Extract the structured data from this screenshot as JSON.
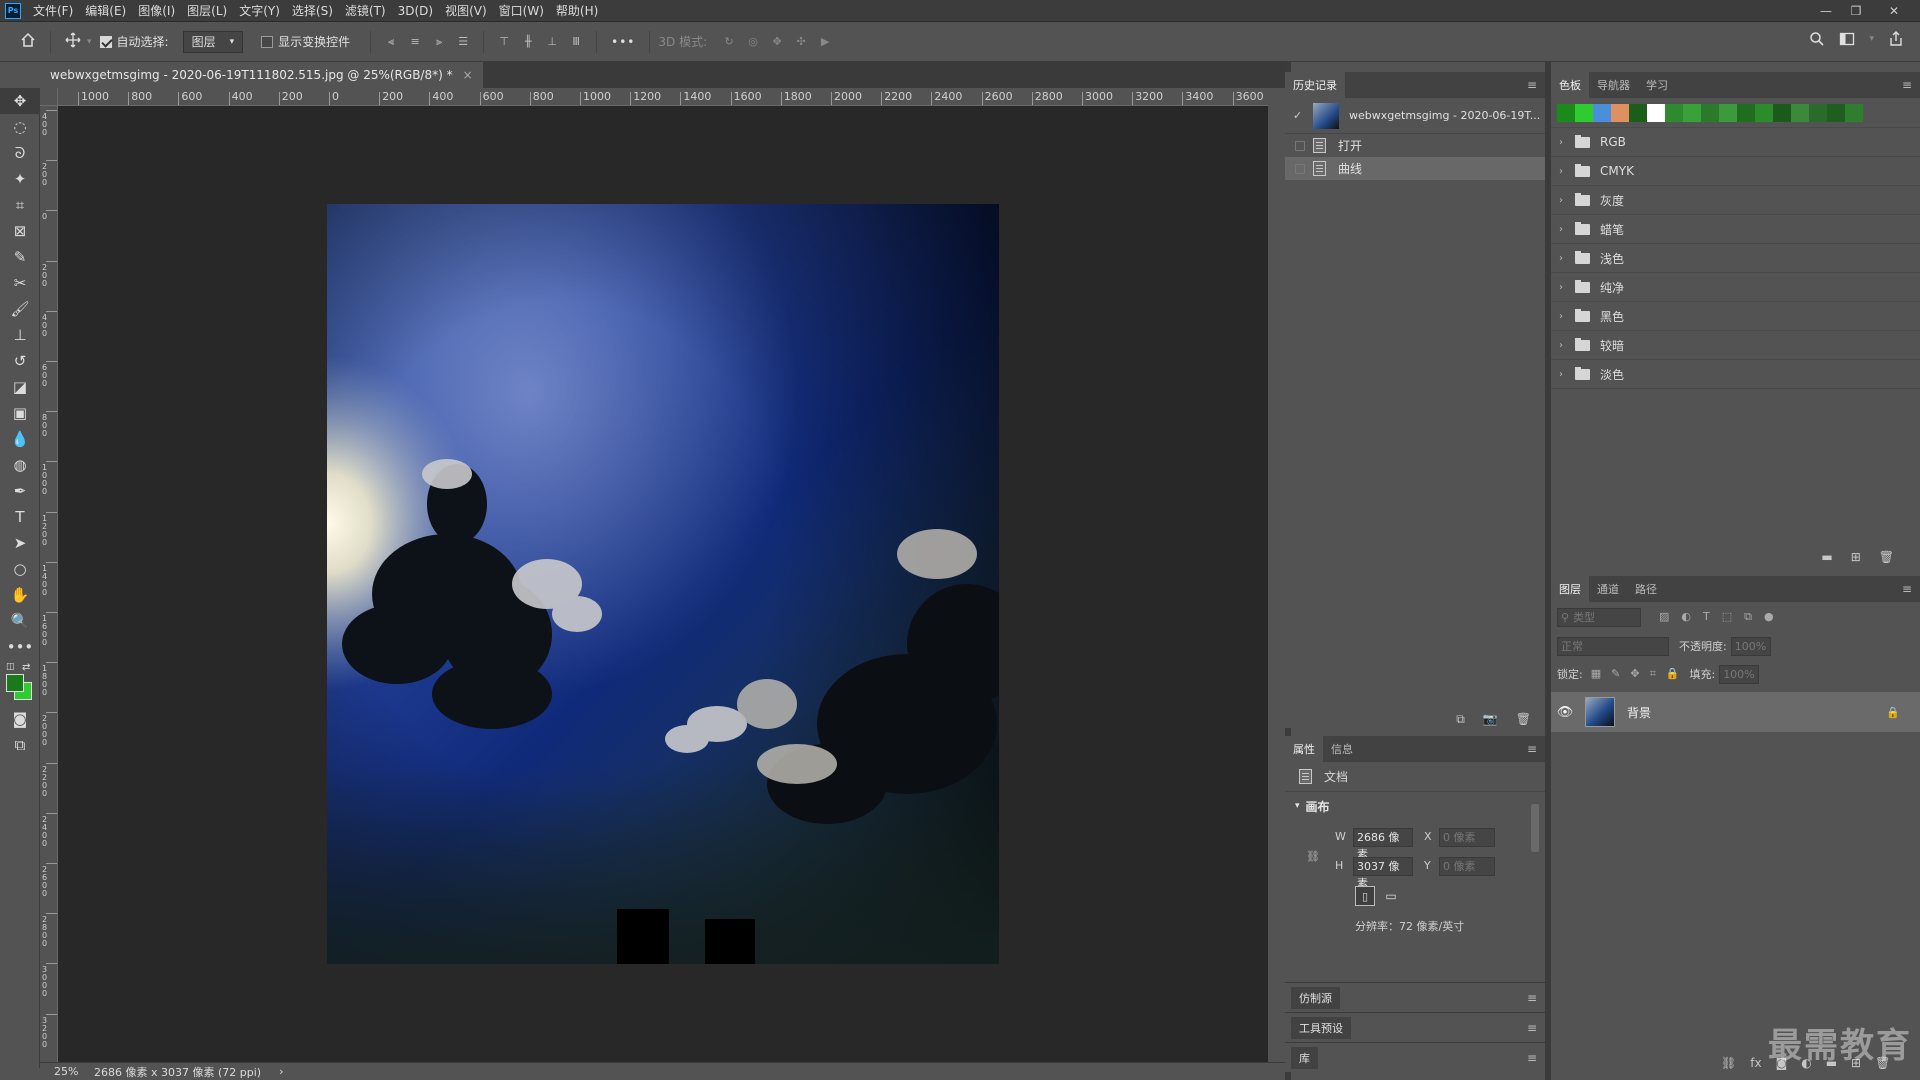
{
  "menu": {
    "logo": "Ps",
    "items": [
      "文件(F)",
      "编辑(E)",
      "图像(I)",
      "图层(L)",
      "文字(Y)",
      "选择(S)",
      "滤镜(T)",
      "3D(D)",
      "视图(V)",
      "窗口(W)",
      "帮助(H)"
    ]
  },
  "options": {
    "auto_select_label": "自动选择:",
    "auto_select_checked": true,
    "auto_select_target": "图层",
    "show_transform_label": "显示变换控件",
    "show_transform_checked": false,
    "more": "•••",
    "mode3d_label": "3D 模式:"
  },
  "document": {
    "tab_title": "webwxgetmsgimg - 2020-06-19T111802.515.jpg @ 25%(RGB/8*) *",
    "close": "×"
  },
  "ruler": {
    "h_ticks": [
      "1000",
      "800",
      "600",
      "400",
      "200",
      "0",
      "200",
      "400",
      "600",
      "800",
      "1000",
      "1200",
      "1400",
      "1600",
      "1800",
      "2000",
      "2200",
      "2400",
      "2600",
      "2800",
      "3000",
      "3200",
      "3400",
      "3600"
    ],
    "v_ticks": [
      "400",
      "200",
      "0",
      "200",
      "400",
      "600",
      "800",
      "1000",
      "1200",
      "1400",
      "1600",
      "1800",
      "2000",
      "2200",
      "2400",
      "2600",
      "2800",
      "3000",
      "3200",
      "3400"
    ]
  },
  "status": {
    "zoom": "25%",
    "info": "2686 像素 x 3037 像素 (72 ppi)",
    "arrow": "›"
  },
  "history": {
    "tab_label": "历史记录",
    "snapshot_name": "webwxgetmsgimg - 2020-06-19T...",
    "steps": [
      {
        "label": "打开",
        "selected": false
      },
      {
        "label": "曲线",
        "selected": true
      }
    ]
  },
  "properties": {
    "tabs": [
      "属性",
      "信息"
    ],
    "doc_label": "文档",
    "section": "画布",
    "w_label": "W",
    "w_value": "2686 像素",
    "h_label": "H",
    "h_value": "3037 像素",
    "x_label": "X",
    "x_value": "0 像素",
    "y_label": "Y",
    "y_value": "0 像素",
    "resolution": "分辨率：72 像素/英寸"
  },
  "collapsed": [
    "仿制源",
    "工具预设",
    "库"
  ],
  "swatches": {
    "tabs": [
      "色板",
      "导航器",
      "学习"
    ],
    "recent_colors": [
      "#1a8a1a",
      "#2ecc2e",
      "#4a8fd9",
      "#e09060",
      "#1a5e1a",
      "#ffffff",
      "#2e8a2e",
      "#3aa03a",
      "#2a7a2a",
      "#3c9a3c",
      "#1e6e1e",
      "#2c8c2c",
      "#1a5a1a",
      "#3a8a3a",
      "#2a6a2a",
      "#1e5e1e",
      "#2e7e2e"
    ],
    "folders": [
      "RGB",
      "CMYK",
      "灰度",
      "蜡笔",
      "浅色",
      "纯净",
      "黑色",
      "较暗",
      "淡色"
    ]
  },
  "layers": {
    "tabs": [
      "图层",
      "通道",
      "路径"
    ],
    "filter_placeholder": "类型",
    "blend_mode": "正常",
    "opacity_label": "不透明度:",
    "opacity_value": "100%",
    "lock_label": "锁定:",
    "fill_label": "填充:",
    "fill_value": "100%",
    "items": [
      {
        "name": "背景",
        "visible": true,
        "locked": true
      }
    ]
  },
  "watermark": "最需教育"
}
